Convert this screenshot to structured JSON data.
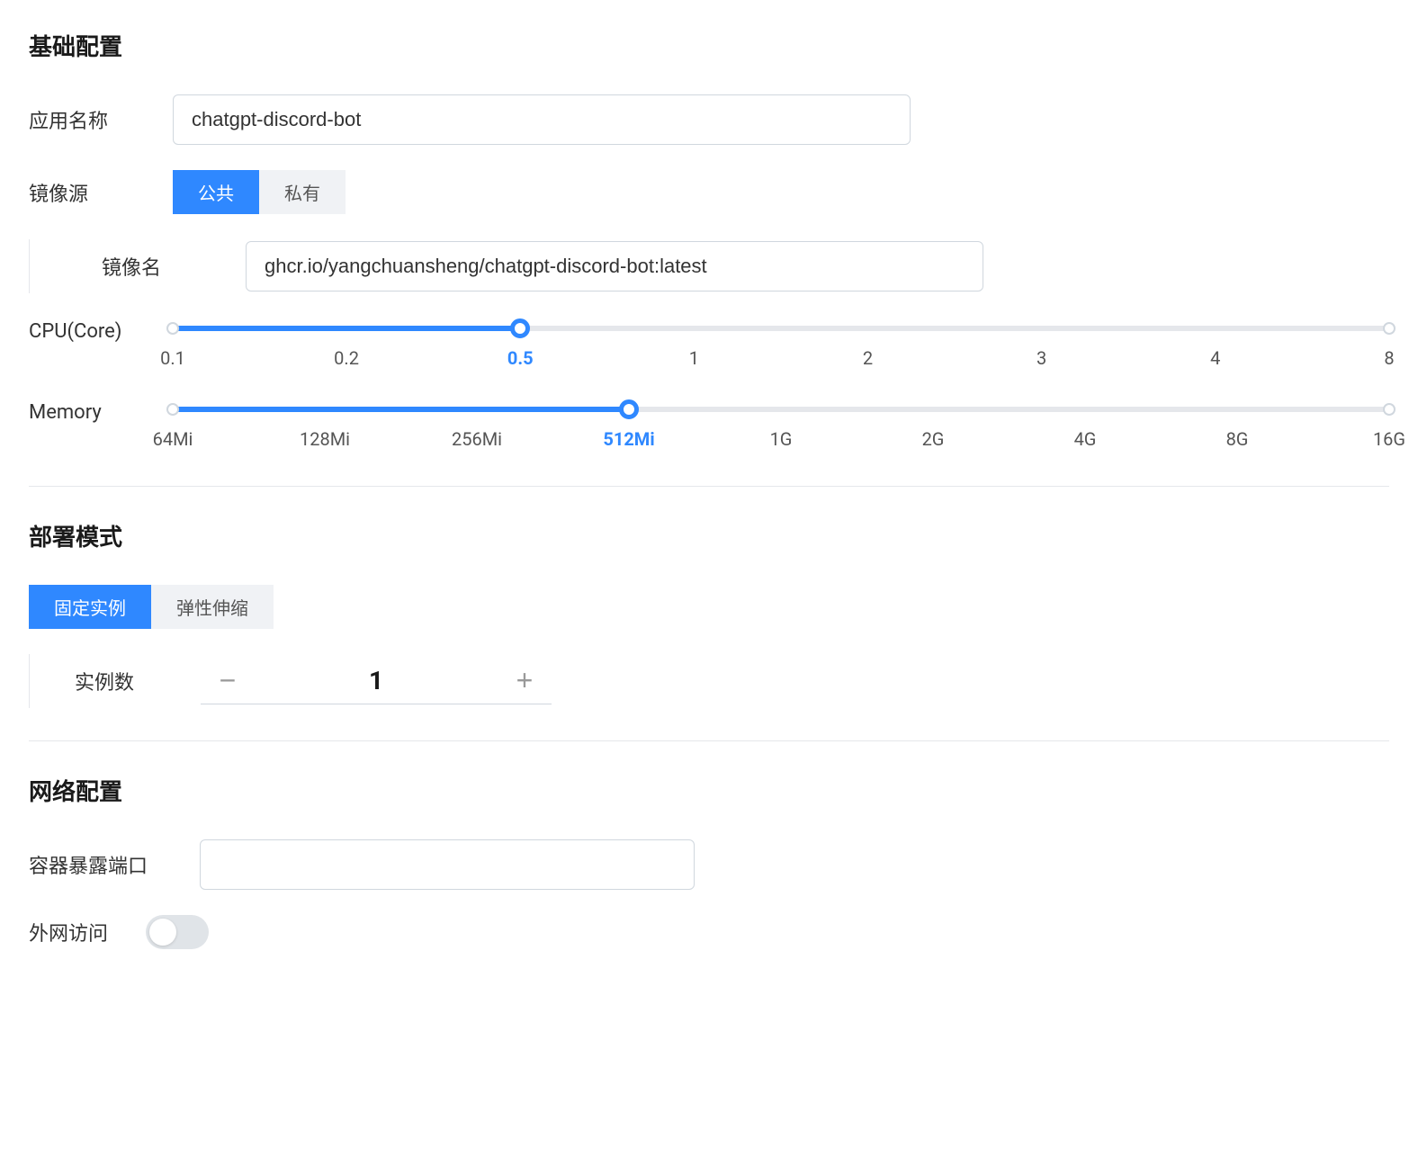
{
  "sections": {
    "basic": {
      "title": "基础配置",
      "app_name_label": "应用名称",
      "app_name_value": "chatgpt-discord-bot",
      "image_source_label": "镜像源",
      "image_source_tabs": {
        "public": "公共",
        "private": "私有"
      },
      "image_name_label": "镜像名",
      "image_name_value": "ghcr.io/yangchuansheng/chatgpt-discord-bot:latest",
      "cpu_label": "CPU(Core)",
      "cpu_ticks": [
        "0.1",
        "0.2",
        "0.5",
        "1",
        "2",
        "3",
        "4",
        "8"
      ],
      "cpu_active_index": 2,
      "memory_label": "Memory",
      "memory_ticks": [
        "64Mi",
        "128Mi",
        "256Mi",
        "512Mi",
        "1G",
        "2G",
        "4G",
        "8G",
        "16G"
      ],
      "memory_active_index": 3
    },
    "deploy": {
      "title": "部署模式",
      "tabs": {
        "fixed": "固定实例",
        "elastic": "弹性伸缩"
      },
      "instance_count_label": "实例数",
      "instance_count_value": "1"
    },
    "network": {
      "title": "网络配置",
      "port_label": "容器暴露端口",
      "port_value": "",
      "external_access_label": "外网访问",
      "external_access_on": false
    }
  }
}
